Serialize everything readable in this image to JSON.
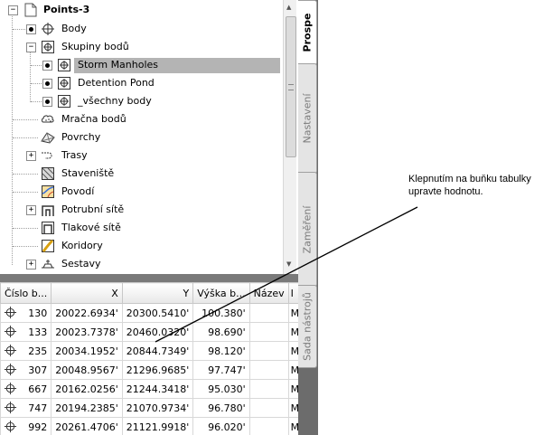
{
  "tree": {
    "root": "Points-3",
    "items": [
      {
        "label": "Body",
        "icon": "point-icon"
      },
      {
        "label": "Skupiny bodů",
        "icon": "point-group-icon"
      },
      {
        "label": "Storm Manholes",
        "icon": "point-group-icon"
      },
      {
        "label": "Detention Pond",
        "icon": "point-group-icon"
      },
      {
        "label": "_všechny body",
        "icon": "point-group-icon"
      },
      {
        "label": "Mračna bodů",
        "icon": "point-cloud-icon"
      },
      {
        "label": "Povrchy",
        "icon": "surface-icon"
      },
      {
        "label": "Trasy",
        "icon": "alignment-icon"
      },
      {
        "label": "Staveniště",
        "icon": "site-icon"
      },
      {
        "label": "Povodí",
        "icon": "catchment-icon"
      },
      {
        "label": "Potrubní sítě",
        "icon": "pipe-network-icon"
      },
      {
        "label": "Tlakové sítě",
        "icon": "pressure-network-icon"
      },
      {
        "label": "Koridory",
        "icon": "corridor-icon"
      },
      {
        "label": "Sestavy",
        "icon": "assembly-icon"
      }
    ]
  },
  "grid": {
    "columns": [
      "Číslo b...",
      "X",
      "Y",
      "Výška b...",
      "Název",
      "I"
    ],
    "rows": [
      {
        "num": "130",
        "x": "20022.6934'",
        "y": "20300.5410'",
        "z": "100.380'",
        "name": "",
        "d": "M"
      },
      {
        "num": "133",
        "x": "20023.7378'",
        "y": "20460.0320'",
        "z": "98.690'",
        "name": "",
        "d": "M"
      },
      {
        "num": "235",
        "x": "20034.1952'",
        "y": "20844.7349'",
        "z": "98.120'",
        "name": "",
        "d": "M"
      },
      {
        "num": "307",
        "x": "20048.9567'",
        "y": "21296.9685'",
        "z": "97.747'",
        "name": "",
        "d": "M"
      },
      {
        "num": "667",
        "x": "20162.0256'",
        "y": "21244.3418'",
        "z": "95.030'",
        "name": "",
        "d": "M"
      },
      {
        "num": "747",
        "x": "20194.2385'",
        "y": "21070.9734'",
        "z": "96.780'",
        "name": "",
        "d": "M"
      },
      {
        "num": "992",
        "x": "20261.4706'",
        "y": "21121.9918'",
        "z": "96.020'",
        "name": "",
        "d": "M"
      }
    ]
  },
  "tabs": [
    "Prospe",
    "Nastavení",
    "Zaměření",
    "Sada nástrojů"
  ],
  "callout": "Klepnutím na buňku tabulky upravte hodnotu.",
  "colors": {
    "selection": "#b4b4b4",
    "panel": "#6c6c6c",
    "splitter": "#7a7a7a"
  }
}
